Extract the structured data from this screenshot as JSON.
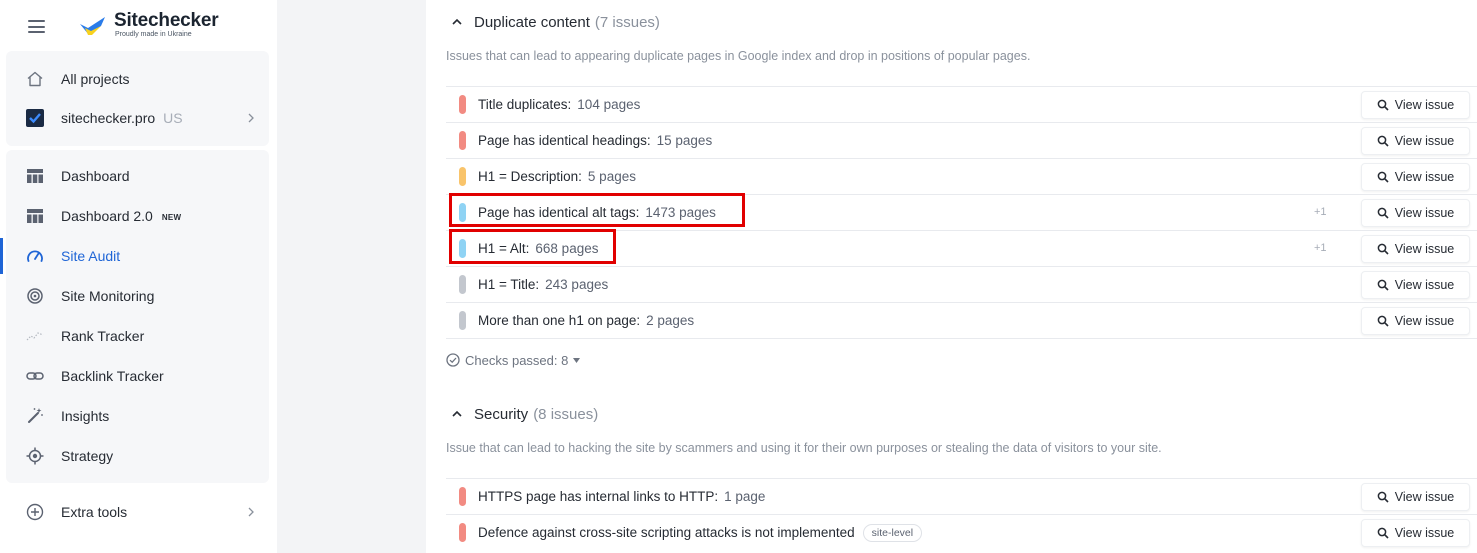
{
  "brand": {
    "name": "Sitechecker",
    "tagline": "Proudly made in Ukraine",
    "color_blue": "#2b7ce9",
    "color_yellow": "#f8d21e"
  },
  "sidebar": {
    "top_items": [
      {
        "label": "All projects",
        "icon": "home-icon"
      },
      {
        "label": "sitechecker.pro",
        "tag": "US",
        "icon": "site-favicon-icon"
      }
    ],
    "items": [
      {
        "label": "Dashboard",
        "icon": "dashboard-icon"
      },
      {
        "label": "Dashboard 2.0",
        "badge": "NEW",
        "icon": "dashboard-icon"
      },
      {
        "label": "Site Audit",
        "icon": "gauge-icon",
        "active": true
      },
      {
        "label": "Site Monitoring",
        "icon": "radar-icon"
      },
      {
        "label": "Rank Tracker",
        "icon": "trend-icon"
      },
      {
        "label": "Backlink Tracker",
        "icon": "link-icon"
      },
      {
        "label": "Insights",
        "icon": "magic-wand-icon"
      },
      {
        "label": "Strategy",
        "icon": "target-icon"
      }
    ],
    "extra": {
      "label": "Extra tools",
      "icon": "plus-circle-icon"
    },
    "active_color": "#1f65d6"
  },
  "duplicate": {
    "title": "Duplicate content",
    "count": "(7 issues)",
    "description": "Issues that can lead to appearing duplicate pages in Google index and drop in positions of popular pages.",
    "issues": [
      {
        "name": "Title duplicates:",
        "count": "104 pages",
        "severity": "error",
        "color": "#f28b82"
      },
      {
        "name": "Page has identical headings:",
        "count": "15 pages",
        "severity": "error",
        "color": "#f28b82"
      },
      {
        "name": "H1 = Description:",
        "count": "5 pages",
        "severity": "warning",
        "color": "#f9c46b"
      },
      {
        "name": "Page has identical alt tags:",
        "count": "1473 pages",
        "severity": "notice",
        "color": "#8fd3f4",
        "plus": "+1"
      },
      {
        "name": "H1 = Alt:",
        "count": "668 pages",
        "severity": "notice",
        "color": "#8fd3f4",
        "plus": "+1"
      },
      {
        "name": "H1 = Title:",
        "count": "243 pages",
        "severity": "info",
        "color": "#c3c7ce"
      },
      {
        "name": "More than one h1 on page:",
        "count": "2 pages",
        "severity": "info",
        "color": "#c3c7ce"
      }
    ],
    "checks_passed": "Checks passed: 8"
  },
  "security": {
    "title": "Security",
    "count": "(8 issues)",
    "description": "Issue that can lead to hacking the site by scammers and using it for their own purposes or stealing the data of visitors to your site.",
    "issues": [
      {
        "name": "HTTPS page has internal links to HTTP:",
        "count": "1 page",
        "severity": "error",
        "color": "#f28b82"
      },
      {
        "name": "Defence against cross-site scripting attacks is not implemented",
        "count": "",
        "tag": "site-level",
        "severity": "error",
        "color": "#f28b82"
      }
    ]
  },
  "view_issue_label": "View issue",
  "highlight_color": "#e10000"
}
